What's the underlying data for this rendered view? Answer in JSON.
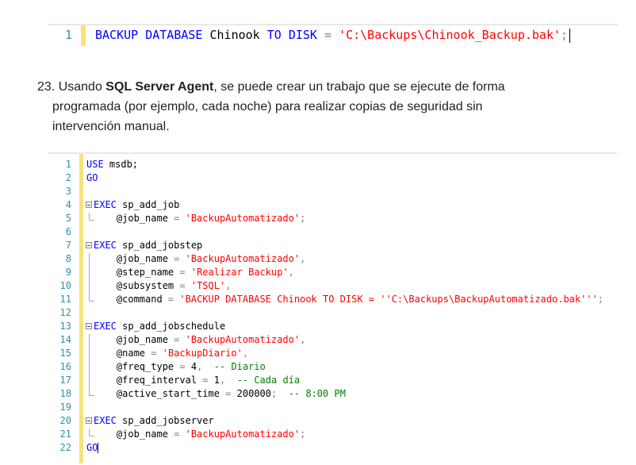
{
  "top_snippet": {
    "line_number": "1",
    "keyword1": "BACKUP DATABASE",
    "db": " Chinook ",
    "keyword2": "TO DISK",
    "eq": " = ",
    "path": "'C:\\Backups\\Chinook_Backup.bak'",
    "semi": ";"
  },
  "paragraph": {
    "number": "23.",
    "before": " Usando ",
    "bold": "SQL Server Agent",
    "line1_after": ", se puede crear un trabajo que se ejecute de forma",
    "line2": "programada (por ejemplo, cada noche) para realizar copias de seguridad sin",
    "line3": "intervención manual."
  },
  "code": {
    "numbers": [
      "1",
      "2",
      "3",
      "4",
      "5",
      "6",
      "7",
      "8",
      "9",
      "10",
      "11",
      "12",
      "13",
      "14",
      "15",
      "16",
      "17",
      "18",
      "19",
      "20",
      "21",
      "22"
    ],
    "l1_kw": "USE",
    "l1_rest": " msdb;",
    "l2_kw": "GO",
    "l4_kw": "EXEC",
    "l4_rest": " sp_add_job",
    "l5_var": "    @job_name",
    "l5_eq": " = ",
    "l5_str": "'BackupAutomatizado'",
    "l5_end": ";",
    "l7_kw": "EXEC",
    "l7_rest": " sp_add_jobstep",
    "l8_var": "    @job_name",
    "l8_eq": " = ",
    "l8_str": "'BackupAutomatizado'",
    "l8_end": ",",
    "l9_var": "    @step_name",
    "l9_eq": " = ",
    "l9_str": "'Realizar Backup'",
    "l9_end": ",",
    "l10_var": "    @subsystem",
    "l10_eq": " = ",
    "l10_str": "'TSQL'",
    "l10_end": ",",
    "l11_var": "    @command",
    "l11_eq": " = ",
    "l11_str": "'BACKUP DATABASE Chinook TO DISK = ''C:\\Backups\\BackupAutomatizado.bak'''",
    "l11_end": ";",
    "l13_kw": "EXEC",
    "l13_rest": " sp_add_jobschedule",
    "l14_var": "    @job_name",
    "l14_eq": " = ",
    "l14_str": "'BackupAutomatizado'",
    "l14_end": ",",
    "l15_var": "    @name",
    "l15_eq": " = ",
    "l15_str": "'BackupDiario'",
    "l15_end": ",",
    "l16_var": "    @freq_type",
    "l16_eq": " = ",
    "l16_num": "4",
    "l16_end": ",  ",
    "l16_cm": "-- Diario",
    "l17_var": "    @freq_interval",
    "l17_eq": " = ",
    "l17_num": "1",
    "l17_end": ",  ",
    "l17_cm": "-- Cada día",
    "l18_var": "    @active_start_time",
    "l18_eq": " = ",
    "l18_num": "200000",
    "l18_end": ";  ",
    "l18_cm": "-- 8:00 PM",
    "l20_kw": "EXEC",
    "l20_rest": " sp_add_jobserver",
    "l21_var": "    @job_name",
    "l21_eq": " = ",
    "l21_str": "'BackupAutomatizado'",
    "l21_end": ";",
    "l22_kw": "GO"
  }
}
